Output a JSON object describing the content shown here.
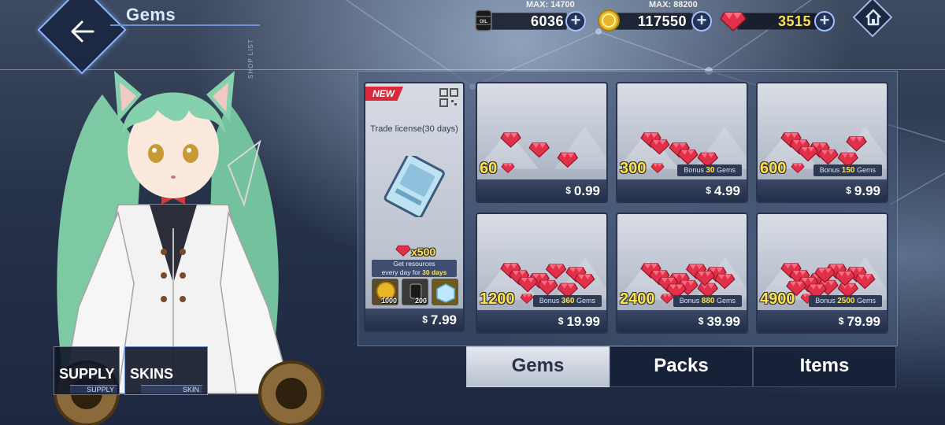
{
  "header": {
    "title": "Gems"
  },
  "resources": [
    {
      "name": "oil",
      "icon": "oil-barrel-icon",
      "max_label": "MAX: 14700",
      "value": "6036"
    },
    {
      "name": "coins",
      "icon": "gold-coin-icon",
      "max_label": "MAX: 88200",
      "value": "117550"
    },
    {
      "name": "gems",
      "icon": "gem-icon",
      "max_label": "",
      "value": "3515"
    }
  ],
  "sidebar": {
    "vertical_label": "SHOP LIST",
    "supply": {
      "label": "SUPPLY",
      "sublabel": "SUPPLY"
    },
    "skins": {
      "label": "SKINS",
      "sublabel": "SKIN"
    }
  },
  "license": {
    "badge": "NEW",
    "title": "Trade license(30 days)",
    "gem_amount": "x500",
    "desc_line1": "Get resources",
    "desc_line2_prefix": "every day for ",
    "desc_line2_bold": "30 days",
    "items": [
      {
        "icon": "gold-coin-icon",
        "qty": "1000"
      },
      {
        "icon": "oil-barrel-icon",
        "qty": "200"
      },
      {
        "icon": "cube-icon",
        "qty": ""
      }
    ],
    "currency": "$",
    "price": "7.99"
  },
  "packs": [
    {
      "gems": "60",
      "bonus_prefix": "",
      "bonus_amount": "",
      "bonus_suffix": "",
      "currency": "$",
      "price": "0.99"
    },
    {
      "gems": "300",
      "bonus_prefix": "Bonus ",
      "bonus_amount": "30",
      "bonus_suffix": " Gems",
      "currency": "$",
      "price": "4.99"
    },
    {
      "gems": "600",
      "bonus_prefix": "Bonus ",
      "bonus_amount": "150",
      "bonus_suffix": " Gems",
      "currency": "$",
      "price": "9.99"
    },
    {
      "gems": "1200",
      "bonus_prefix": "Bonus ",
      "bonus_amount": "360",
      "bonus_suffix": " Gems",
      "currency": "$",
      "price": "19.99"
    },
    {
      "gems": "2400",
      "bonus_prefix": "Bonus ",
      "bonus_amount": "880",
      "bonus_suffix": " Gems",
      "currency": "$",
      "price": "39.99"
    },
    {
      "gems": "4900",
      "bonus_prefix": "Bonus ",
      "bonus_amount": "2500",
      "bonus_suffix": " Gems",
      "currency": "$",
      "price": "79.99"
    }
  ],
  "tabs": [
    {
      "label": "Gems",
      "active": true
    },
    {
      "label": "Packs",
      "active": false
    },
    {
      "label": "Items",
      "active": false
    }
  ],
  "colors": {
    "accent_yellow": "#ffe14a",
    "gem_red": "#e0304a",
    "plus_blue": "#9fc1ff",
    "new_badge": "#d9293a"
  }
}
